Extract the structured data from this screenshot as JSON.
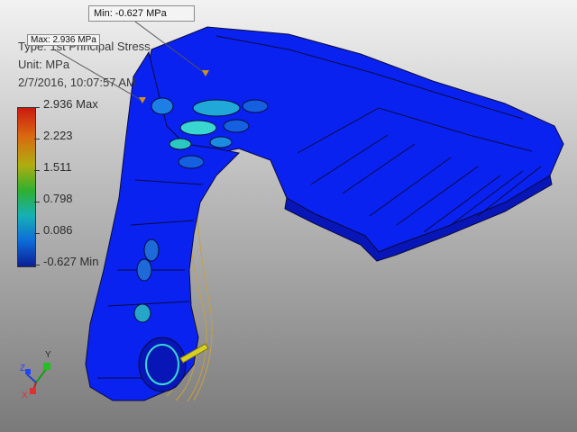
{
  "annotations": {
    "min_label": "Min: -0.627 MPa",
    "max_label": "Max: 2.936 MPa"
  },
  "result_info": {
    "type": "Type: 1st Principal Stress",
    "unit": "Unit: MPa",
    "timestamp": "2/7/2016, 10:07:57 AM"
  },
  "legend": {
    "levels": [
      "2.936 Max",
      "2.223",
      "1.511",
      "0.798",
      "0.086",
      "-0.627 Min"
    ],
    "colors": [
      "#cc1a10",
      "#d96a10",
      "#b0ad10",
      "#2fb02f",
      "#16b0b5",
      "#0d6bd9",
      "#0a1e95"
    ]
  },
  "triad": {
    "x": "X",
    "y": "Y",
    "z": "Z"
  },
  "model_colors": {
    "base": "#0a22f0",
    "edge": "#0a0a40",
    "hot": "#3ad6d0",
    "deformed_outline": "#c8a040"
  }
}
